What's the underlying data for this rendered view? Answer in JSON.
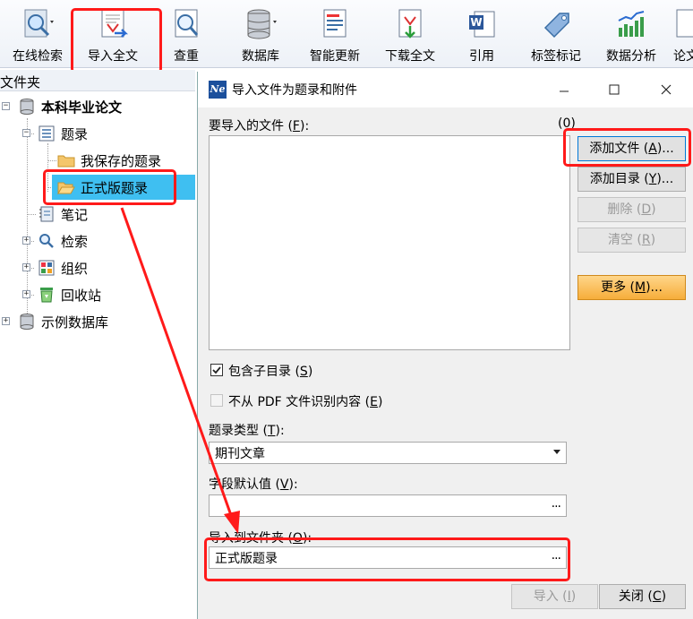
{
  "toolbar": {
    "items": [
      {
        "label": "在线检索",
        "icon": "online-search-icon"
      },
      {
        "label": "导入全文",
        "icon": "import-fulltext-icon"
      },
      {
        "label": "查重",
        "icon": "duplicate-check-icon"
      },
      {
        "label": "数据库",
        "icon": "database-icon"
      },
      {
        "label": "智能更新",
        "icon": "smart-update-icon"
      },
      {
        "label": "下载全文",
        "icon": "download-fulltext-icon"
      },
      {
        "label": "引用",
        "icon": "cite-icon"
      },
      {
        "label": "标签标记",
        "icon": "tag-icon"
      },
      {
        "label": "数据分析",
        "icon": "analysis-icon"
      },
      {
        "label": "论文",
        "icon": "paper-icon"
      }
    ]
  },
  "tree": {
    "header": "文件夹",
    "items": [
      {
        "label": "本科毕业论文",
        "icon": "database-icon"
      },
      {
        "label": "题录",
        "icon": "list-icon"
      },
      {
        "label": "我保存的题录",
        "icon": "folder-icon"
      },
      {
        "label": "正式版题录",
        "icon": "folder-open-icon"
      },
      {
        "label": "笔记",
        "icon": "notebook-icon"
      },
      {
        "label": "检索",
        "icon": "magnifier-icon"
      },
      {
        "label": "组织",
        "icon": "grid-icon"
      },
      {
        "label": "回收站",
        "icon": "recycle-icon"
      },
      {
        "label": "示例数据库",
        "icon": "database-icon"
      }
    ]
  },
  "dialog": {
    "title": "导入文件为题录和附件",
    "files_label_pre": "要导入的文件 (",
    "files_label_key": "F",
    "files_label_post": "):",
    "file_count": "(0)",
    "buttons": {
      "add_file": {
        "pre": "添加文件 (",
        "key": "A",
        "post": ")..."
      },
      "add_dir": {
        "pre": "添加目录 (",
        "key": "Y",
        "post": ")..."
      },
      "delete": {
        "pre": "删除 (",
        "key": "D",
        "post": ")"
      },
      "clear": {
        "pre": "清空 (",
        "key": "R",
        "post": ")"
      },
      "more": {
        "pre": "更多 (",
        "key": "M",
        "post": ")..."
      }
    },
    "include_subdirs": {
      "pre": "包含子目录 (",
      "key": "S",
      "post": ")",
      "checked": true
    },
    "no_pdf_recognition": {
      "pre": "不从 PDF 文件识别内容 (",
      "key": "E",
      "post": ")",
      "checked": false
    },
    "type_label": {
      "pre": "题录类型 (",
      "key": "T",
      "post": "):"
    },
    "type_value": "期刊文章",
    "default_label": {
      "pre": "字段默认值 (",
      "key": "V",
      "post": "):"
    },
    "default_value": "",
    "folder_label": {
      "pre": "导入到文件夹 (",
      "key": "O",
      "post": "):"
    },
    "folder_value": "正式版题录",
    "dots": "...",
    "import_btn": {
      "pre": "导入 (",
      "key": "I",
      "post": ")"
    },
    "close_btn": {
      "pre": "关闭 (",
      "key": "C",
      "post": ")"
    }
  },
  "colors": {
    "annotation_red": "#ff1a1a",
    "selection": "#3fbff1",
    "more_button": "#f6ad3a"
  }
}
